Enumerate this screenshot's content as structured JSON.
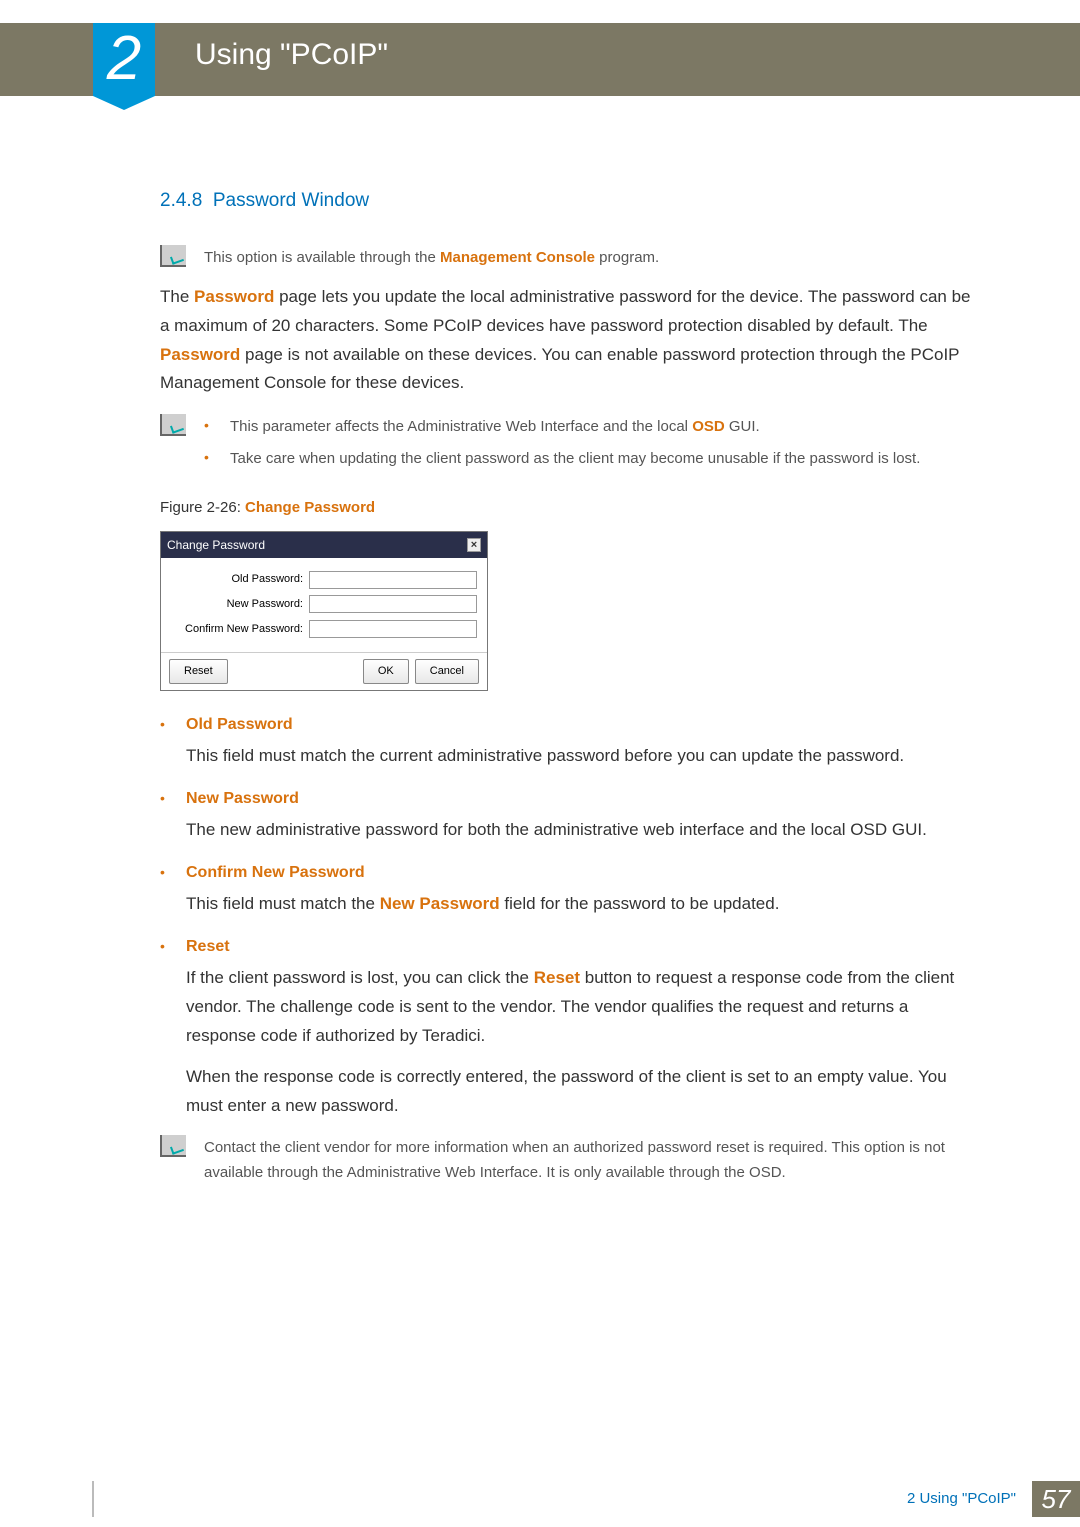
{
  "chapter": {
    "number": "2",
    "title": "Using \"PCoIP\""
  },
  "section": {
    "number": "2.4.8",
    "title": "Password Window"
  },
  "note1_pre": "This option is available through the ",
  "note1_hl": "Management Console",
  "note1_post": " program.",
  "para1_pre": "The ",
  "para1_hl": "Password",
  "para1_post": " page lets you update the local administrative password for the device. The password can be a maximum of 20 characters. Some PCoIP devices have password protection disabled by default. The ",
  "para1_hl2": "Password",
  "para1_post2": " page is not available on these devices. You can enable password protection through the PCoIP Management Console for these devices.",
  "note2_b1_pre": "This parameter affects the Administrative Web Interface and the local ",
  "note2_b1_hl": "OSD",
  "note2_b1_post": " GUI.",
  "note2_b2": "Take care when updating the client password as the client may become unusable if the password is lost.",
  "figure_pre": "Figure 2-26: ",
  "figure_hl": "Change Password",
  "dialog": {
    "title": "Change Password",
    "old": "Old Password:",
    "new": "New Password:",
    "confirm": "Confirm New Password:",
    "reset": "Reset",
    "ok": "OK",
    "cancel": "Cancel"
  },
  "fields": {
    "old_title": "Old Password",
    "old_desc": "This field must match the current administrative password before you can update the password.",
    "new_title": "New Password",
    "new_desc": "The new administrative password for both the administrative web interface and the local OSD GUI.",
    "confirm_title": "Confirm New Password",
    "confirm_desc_pre": "This field must match the ",
    "confirm_desc_hl": "New Password",
    "confirm_desc_post": " field for the password to be updated.",
    "reset_title": "Reset",
    "reset_p1_pre": "If the client password is lost, you can click the ",
    "reset_p1_hl": "Reset",
    "reset_p1_post": " button to request a response code from the client vendor. The challenge code is sent to the vendor. The vendor qualifies the request and returns a response code if authorized by Teradici.",
    "reset_p2": "When the response code is correctly entered, the password of the client is set to an empty value. You must enter a new password."
  },
  "note3": "Contact the client vendor for more information when an authorized password reset is required. This option is not available through the Administrative Web Interface. It is only available through the OSD.",
  "footer": {
    "label": "2 Using \"PCoIP\"",
    "page": "57"
  }
}
